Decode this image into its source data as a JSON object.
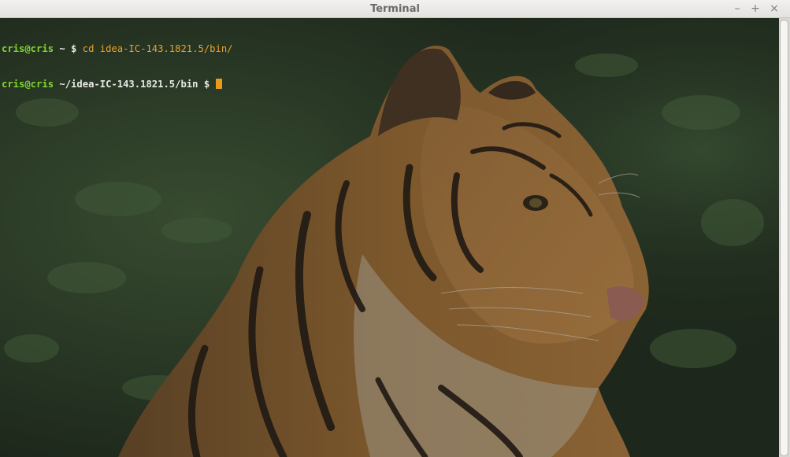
{
  "window": {
    "title": "Terminal",
    "minimize_label": "–",
    "maximize_label": "+",
    "close_label": "×"
  },
  "terminal": {
    "lines": [
      {
        "user": "cris@cris",
        "path": " ~ $ ",
        "command": "cd idea-IC-143.1821.5/bin/"
      },
      {
        "user": "cris@cris",
        "path": " ~/idea-IC-143.1821.5/bin $ ",
        "command": ""
      }
    ],
    "colors": {
      "prompt_user": "#7fd62e",
      "prompt_path": "#e8e8e8",
      "command": "#e8a32c",
      "cursor": "#e89a1e"
    },
    "background_image": "tiger-in-foliage"
  }
}
